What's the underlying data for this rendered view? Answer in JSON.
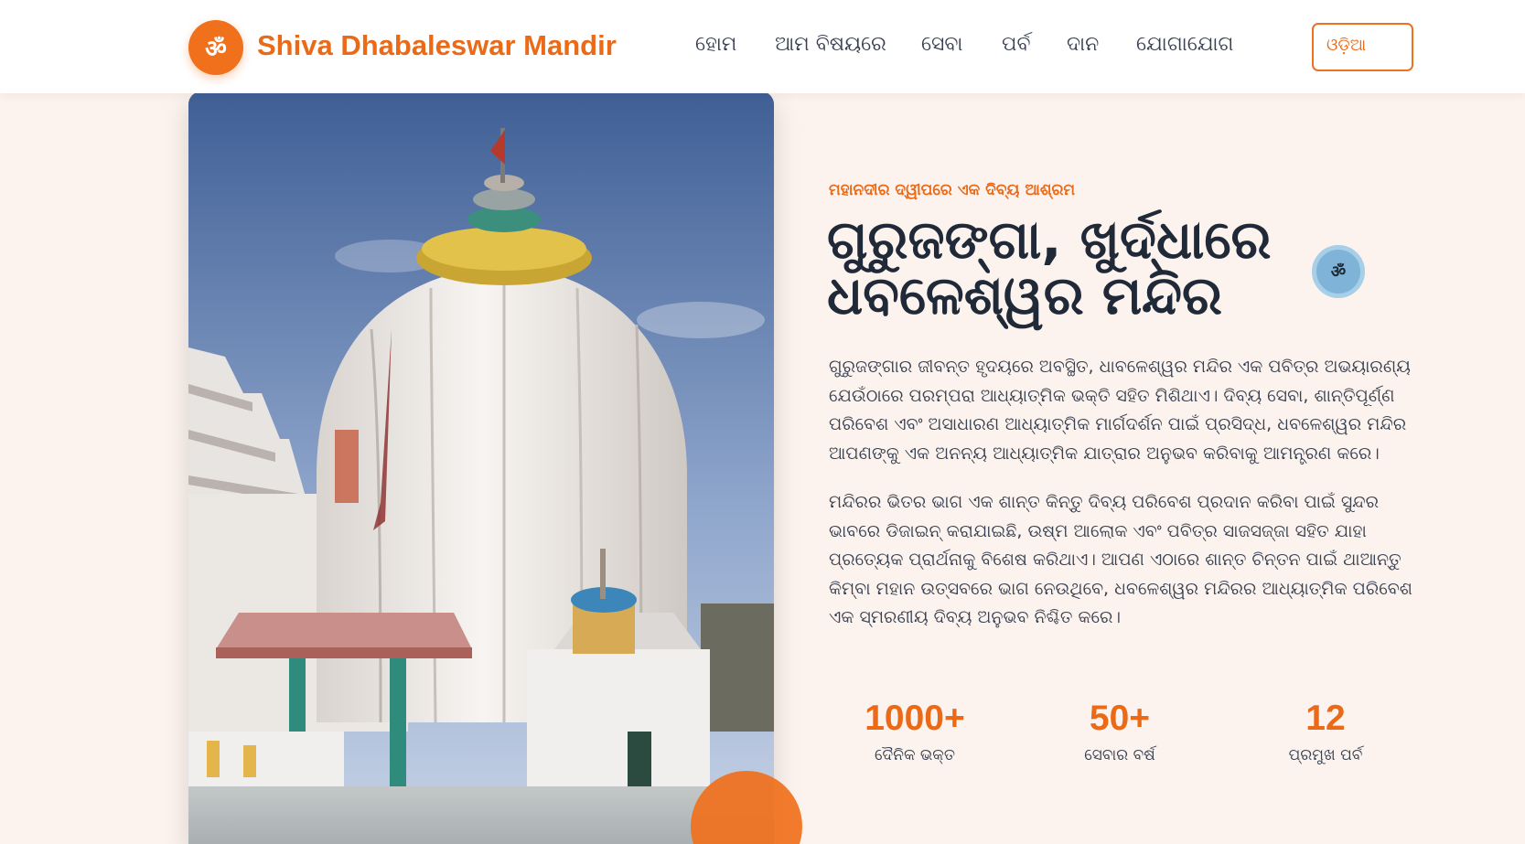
{
  "header": {
    "logo_symbol": "ॐ",
    "brand": "Shiva Dhabaleswar Mandir",
    "nav": [
      "ହୋମ",
      "ଆମ ବିଷୟରେ",
      "ସେବା",
      "ପର୍ବ",
      "ଦାନ",
      "ଯୋଗାଯୋଗ"
    ],
    "language_button": "ଓଡ଼ିଆ"
  },
  "hero": {
    "eyebrow": "ମହାନଦୀର ଦ୍ୱୀପରେ ଏକ ଦିବ୍ୟ ଆଶ୍ରମ",
    "headline": "ଗୁରୁଜଙ୍ଗା, ଖୁର୍ଦ୍ଧାରେ ଧବଳେଶ୍ୱର ମନ୍ଦିର",
    "om_badge": "ॐ",
    "paragraph1": "ଗୁରୁଜଙ୍ଗାର ଜୀବନ୍ତ ହୃଦୟରେ ଅବସ୍ଥିତ, ଧାବଳେଶ୍ୱର ମନ୍ଦିର ଏକ ପବିତ୍ର ଅଭୟାରଣ୍ୟ ଯେଉଁଠାରେ ପରମ୍ପରା ଆଧ୍ୟାତ୍ମିକ ଭକ୍ତି ସହିତ ମିଶିଥାଏ। ଦିବ୍ୟ ସେବା, ଶାନ୍ତିପୂର୍ଣ୍ଣ ପରିବେଶ ଏବଂ ଅସାଧାରଣ ଆଧ୍ୟାତ୍ମିକ ମାର୍ଗଦର୍ଶନ ପାଇଁ ପ୍ରସିଦ୍ଧ, ଧବଳେଶ୍ୱର ମନ୍ଦିର ଆପଣଙ୍କୁ ଏକ ଅନନ୍ୟ ଆଧ୍ୟାତ୍ମିକ ଯାତ୍ରାର ଅନୁଭବ କରିବାକୁ ଆମନ୍ତ୍ରଣ କରେ।",
    "paragraph2": "ମନ୍ଦିରର ଭିତର ଭାଗ ଏକ ଶାନ୍ତ କିନ୍ତୁ ଦିବ୍ୟ ପରିବେଶ ପ୍ରଦାନ କରିବା ପାଇଁ ସୁନ୍ଦର ଭାବରେ ଡିଜାଇନ୍ କରାଯାଇଛି, ଉଷ୍ମ ଆଲୋକ ଏବଂ ପବିତ୍ର ସାଜସଜ୍ଜା ସହିତ ଯାହା ପ୍ରତ୍ୟେକ ପ୍ରାର୍ଥନାକୁ ବିଶେଷ କରିଥାଏ। ଆପଣ ଏଠାରେ ଶାନ୍ତ ଚିନ୍ତନ ପାଇଁ ଥାଆନ୍ତୁ କିମ୍ବା ମହାନ ଉତ୍ସବରେ ଭାଗ ନେଉଥିବେ, ଧବଳେଶ୍ୱର ମନ୍ଦିରର ଆଧ୍ୟାତ୍ମିକ ପରିବେଶ ଏକ ସ୍ମରଣୀୟ ଦିବ୍ୟ ଅନୁଭବ ନିଶ୍ଚିତ କରେ।"
  },
  "stats": [
    {
      "value": "1000+",
      "label": "ଦୈନିକ ଭକ୍ତ"
    },
    {
      "value": "50+",
      "label": "ସେବାର ବର୍ଷ"
    },
    {
      "value": "12",
      "label": "ପ୍ରମୁଖ ପର୍ବ"
    }
  ],
  "colors": {
    "accent": "#f0701c",
    "page_background": "#fdf3ee",
    "heading": "#1f2937"
  }
}
